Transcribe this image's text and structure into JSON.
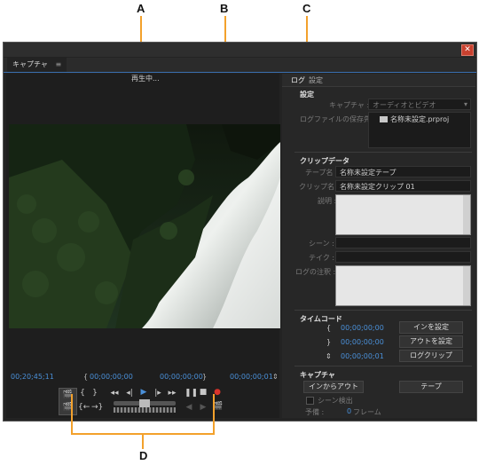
{
  "callouts": {
    "a": "A",
    "b": "B",
    "c": "C",
    "d": "D"
  },
  "window": {
    "tab_label": "キャプチャ",
    "tab_menu_icon": "≡",
    "close_icon": "✕"
  },
  "monitor": {
    "status": "再生中...",
    "current_timecode": "00;20;45;11",
    "in_point": "00;00;00;00",
    "out_point": "00;00;00;00",
    "duration": "00;00;00;01"
  },
  "panel": {
    "tab_log": "ログ",
    "tab_settings": "設定",
    "settings": {
      "heading": "設定",
      "capture_label": "キャプチャ :",
      "capture_value": "オーディオとビデオ",
      "save_location_label": "ログファイルの保存先 :",
      "save_location_value": "名称未設定.prproj"
    },
    "clip_data": {
      "heading": "クリップデータ",
      "tape_name_label": "テープ名 :",
      "tape_name_value": "名称未設定テープ",
      "clip_name_label": "クリップ名 :",
      "clip_name_value": "名称未設定クリップ 01",
      "description_label": "説明 :",
      "scene_label": "シーン :",
      "take_label": "テイク :",
      "log_note_label": "ログの注釈 :"
    },
    "timecode": {
      "heading": "タイムコード",
      "in_value": "00;00;00;00",
      "out_value": "00;00;00;00",
      "duration_value": "00;00;00;01",
      "set_in_button": "インを設定",
      "set_out_button": "アウトを設定",
      "log_clip_button": "ログクリップ"
    },
    "capture": {
      "heading": "キャプチャ",
      "in_out_button": "インからアウト",
      "tape_button": "テープ",
      "scene_detect_label": "シーン検出",
      "handles_label": "予備 :",
      "handles_value": "0",
      "frames_label": "フレーム"
    }
  }
}
